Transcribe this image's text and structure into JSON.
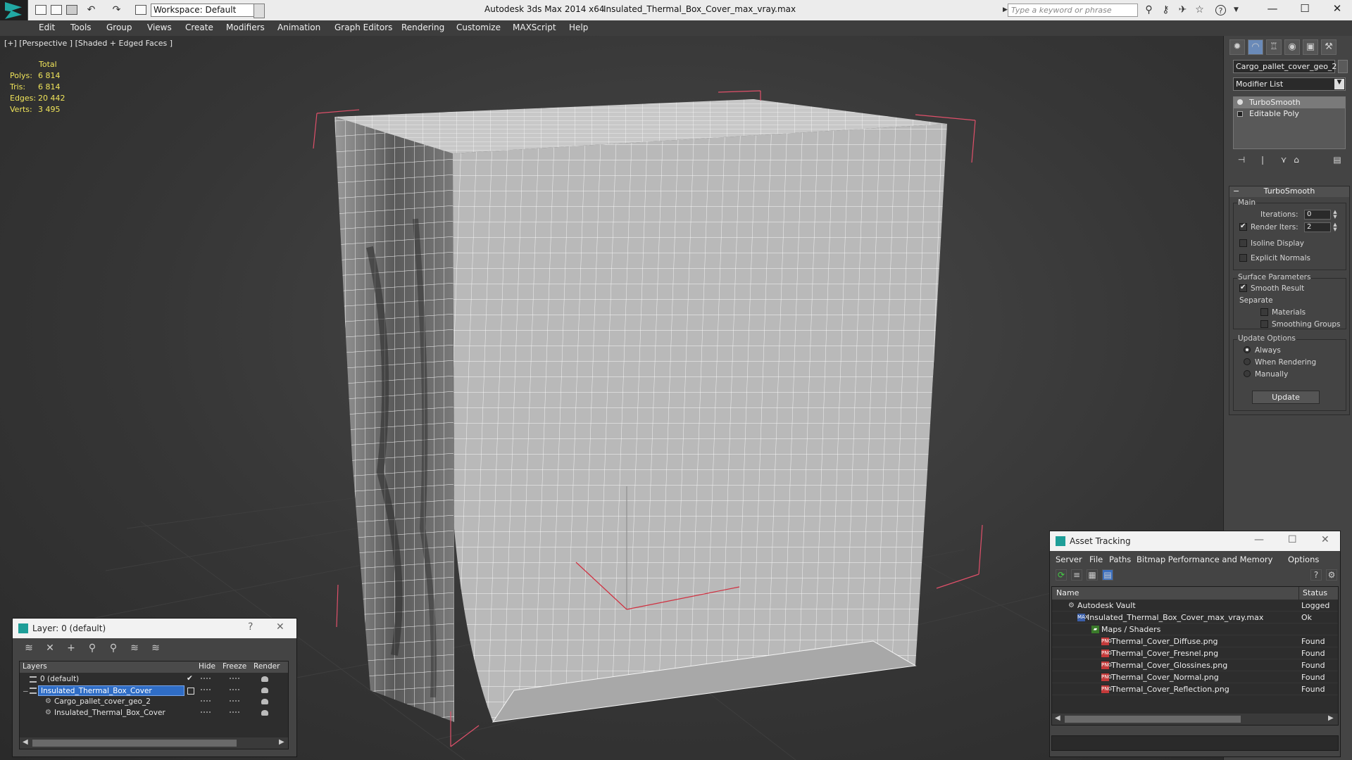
{
  "titlebar": {
    "workspace": "Workspace: Default",
    "app_title": "Autodesk 3ds Max  2014 x64",
    "file_title": "Insulated_Thermal_Box_Cover_max_vray.max",
    "search_placeholder": "Type a keyword or phrase"
  },
  "menu": [
    "Edit",
    "Tools",
    "Group",
    "Views",
    "Create",
    "Modifiers",
    "Animation",
    "Graph Editors",
    "Rendering",
    "Customize",
    "MAXScript",
    "Help"
  ],
  "viewport": {
    "label": "[+] [Perspective ] [Shaded + Edged Faces ]",
    "stats_header": "Total",
    "stats": [
      {
        "k": "Polys:",
        "v": "6 814"
      },
      {
        "k": "Tris:",
        "v": "6 814"
      },
      {
        "k": "Edges:",
        "v": "20 442"
      },
      {
        "k": "Verts:",
        "v": "3 495"
      }
    ]
  },
  "command_panel": {
    "object_name": "Cargo_pallet_cover_geo_2",
    "modifier_list": "Modifier List",
    "stack": [
      "TurboSmooth",
      "Editable Poly"
    ],
    "rollout_title": "TurboSmooth",
    "main_label": "Main",
    "iterations_label": "Iterations:",
    "iterations_value": "0",
    "render_iters_label": "Render Iters:",
    "render_iters_value": "2",
    "isoline_label": "Isoline Display",
    "explicit_normals_label": "Explicit Normals",
    "surface_params_label": "Surface Parameters",
    "smooth_result_label": "Smooth Result",
    "separate_label": "Separate",
    "materials_label": "Materials",
    "smoothing_groups_label": "Smoothing Groups",
    "update_options_label": "Update Options",
    "always_label": "Always",
    "when_rendering_label": "When Rendering",
    "manually_label": "Manually",
    "update_button": "Update"
  },
  "layer_window": {
    "title": "Layer: 0 (default)",
    "help": "?",
    "columns": {
      "layers": "Layers",
      "hide": "Hide",
      "freeze": "Freeze",
      "render": "Render"
    },
    "rows": [
      {
        "name": "0 (default)"
      },
      {
        "name": "Insulated_Thermal_Box_Cover"
      },
      {
        "name": "Cargo_pallet_cover_geo_2"
      },
      {
        "name": "Insulated_Thermal_Box_Cover"
      }
    ]
  },
  "asset_window": {
    "title": "Asset Tracking",
    "menu": [
      "Server",
      "File",
      "Paths",
      "Bitmap Performance and Memory",
      "Options"
    ],
    "columns": {
      "name": "Name",
      "status": "Status"
    },
    "rows": [
      {
        "name": "Autodesk Vault",
        "status": "Logged"
      },
      {
        "name": "Insulated_Thermal_Box_Cover_max_vray.max",
        "status": "Ok"
      },
      {
        "name": "Maps / Shaders",
        "status": ""
      },
      {
        "name": "Thermal_Cover_Diffuse.png",
        "status": "Found"
      },
      {
        "name": "Thermal_Cover_Fresnel.png",
        "status": "Found"
      },
      {
        "name": "Thermal_Cover_Glossines.png",
        "status": "Found"
      },
      {
        "name": "Thermal_Cover_Normal.png",
        "status": "Found"
      },
      {
        "name": "Thermal_Cover_Reflection.png",
        "status": "Found"
      }
    ]
  },
  "colors": {
    "accent": "#21a8a3",
    "selection": "#2f6dc6",
    "stats": "#f0e45a",
    "bbox": "#e0506a"
  }
}
